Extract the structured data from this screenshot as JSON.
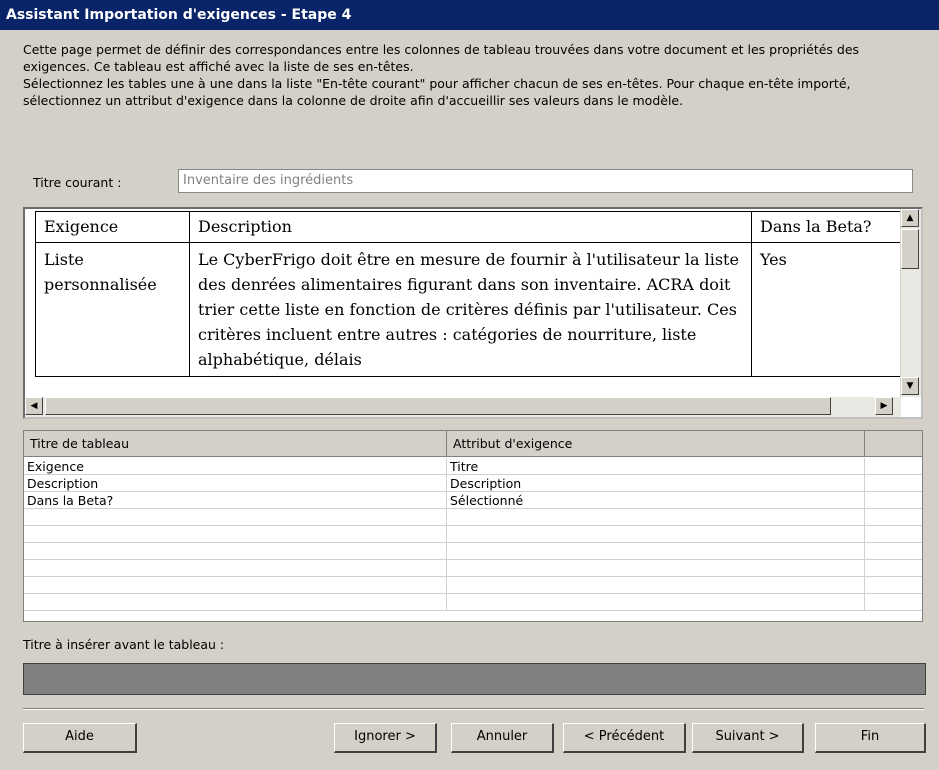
{
  "window": {
    "title": "Assistant Importation d'exigences - Etape 4"
  },
  "intro": {
    "line1": "Cette page permet de définir des correspondances entre les colonnes de tableau trouvées dans votre document et les propriétés des exigences. Ce tableau est affiché avec la liste de ses en-têtes.",
    "line2": "Sélectionnez les tables une à une dans la liste \"En-tête courant\" pour afficher chacun de ses en-têtes. Pour chaque en-tête importé, sélectionnez un attribut d'exigence dans la colonne de droite afin d'accueillir ses valeurs dans le modèle."
  },
  "current_title": {
    "label": "Titre courant :",
    "value": "Inventaire des ingrédients"
  },
  "preview": {
    "headers": [
      "Exigence",
      "Description",
      "Dans la Beta?"
    ],
    "row": {
      "exigence": "Liste personnalisée",
      "description": "Le CyberFrigo doit être en mesure de fournir à l'utilisateur la liste des denrées alimentaires figurant dans son inventaire. ACRA doit trier cette liste en fonction de critères définis par l'utilisateur. Ces critères incluent entre autres : catégories de nourriture, liste alphabétique, délais",
      "beta": "Yes"
    }
  },
  "mapping": {
    "headers": [
      "Titre de tableau",
      "Attribut d'exigence"
    ],
    "rows": [
      [
        "Exigence",
        "Titre"
      ],
      [
        "Description",
        "Description"
      ],
      [
        "Dans la Beta?",
        "Sélectionné"
      ]
    ]
  },
  "insert": {
    "label": "Titre à insérer avant le tableau :",
    "value": ""
  },
  "buttons": {
    "help": "Aide",
    "ignore": "Ignorer >",
    "cancel": "Annuler",
    "previous": "< Précédent",
    "next": "Suivant >",
    "finish": "Fin"
  }
}
